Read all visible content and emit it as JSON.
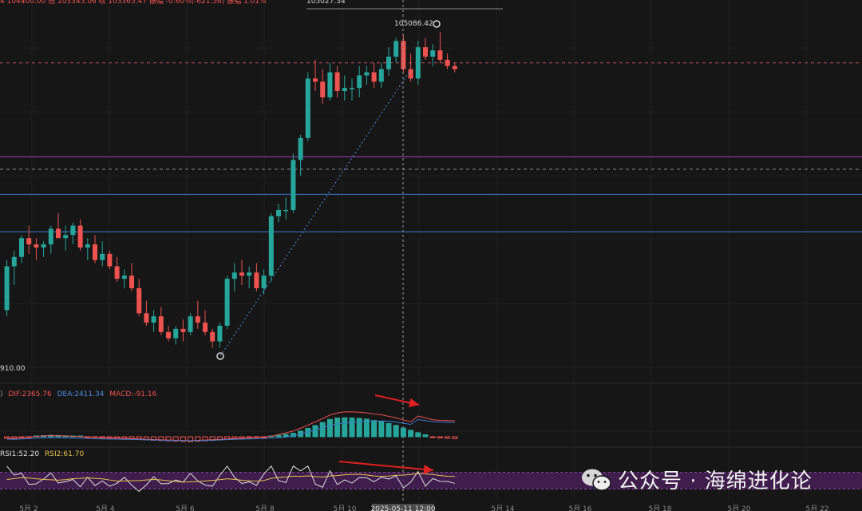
{
  "header": {
    "ohlc_text": "4 104400.00 低 103345.06 收 103365.47 振幅 -0.60%(-621.56) 振幅 1.01%",
    "top_price_label": "105027.34"
  },
  "price_labels": {
    "high": "105086.42",
    "low": "910.00"
  },
  "indicators": {
    "macd_prefix": ")",
    "dif": "DIF:2365.76",
    "dea": "DEA:2411.34",
    "macd": "MACD:-91.16",
    "rsi1": "RSI1:52.20",
    "rsi2": "RSI2:61.70"
  },
  "time_axis": {
    "ticks": [
      "5月 2",
      "5月 4",
      "5月 6",
      "5月 8",
      "5月 10",
      "5月 14",
      "5月 16",
      "5月 18",
      "5月 20",
      "5月 22"
    ],
    "crosshair": "2025-05-11 12:00"
  },
  "watermark": {
    "text": "公众号 · 海绵进化论",
    "icon": "wechat-icon"
  },
  "colors": {
    "up": "#26a69a",
    "down": "#ef5350",
    "background": "#161616"
  },
  "chart_data": {
    "type": "candlestick",
    "asset": "BTC",
    "interval": "4h",
    "candles": [
      [
        96200,
        97800,
        96000,
        97600
      ],
      [
        97600,
        98100,
        97000,
        97900
      ],
      [
        97900,
        98600,
        97700,
        98500
      ],
      [
        98500,
        98900,
        98000,
        98300
      ],
      [
        98300,
        98500,
        97800,
        98200
      ],
      [
        98200,
        98400,
        97900,
        98300
      ],
      [
        98300,
        98900,
        98000,
        98800
      ],
      [
        98800,
        99300,
        98500,
        98500
      ],
      [
        98500,
        98900,
        98100,
        98600
      ],
      [
        98600,
        99000,
        98300,
        98900
      ],
      [
        98900,
        99100,
        98100,
        98200
      ],
      [
        98200,
        98500,
        97800,
        98300
      ],
      [
        98300,
        98600,
        97700,
        97800
      ],
      [
        97800,
        98400,
        97600,
        98000
      ],
      [
        98000,
        98100,
        97500,
        97600
      ],
      [
        97600,
        97900,
        97100,
        97200
      ],
      [
        97200,
        97500,
        96900,
        97300
      ],
      [
        97300,
        97700,
        96800,
        96900
      ],
      [
        96900,
        97200,
        96000,
        96100
      ],
      [
        96100,
        96500,
        95700,
        95800
      ],
      [
        95800,
        96200,
        95500,
        96000
      ],
      [
        96000,
        96300,
        95400,
        95500
      ],
      [
        95500,
        95700,
        95200,
        95300
      ],
      [
        95300,
        95700,
        95100,
        95600
      ],
      [
        95600,
        95900,
        95200,
        95500
      ],
      [
        95500,
        96100,
        95400,
        96000
      ],
      [
        96000,
        96500,
        95600,
        95800
      ],
      [
        95800,
        96200,
        95400,
        95500
      ],
      [
        95500,
        95600,
        95000,
        95200
      ],
      [
        95200,
        95800,
        95000,
        95700
      ],
      [
        95700,
        97300,
        95600,
        97200
      ],
      [
        97200,
        97700,
        96800,
        97400
      ],
      [
        97400,
        97800,
        97000,
        97300
      ],
      [
        97300,
        97600,
        96900,
        97400
      ],
      [
        97400,
        97700,
        96800,
        96900
      ],
      [
        96900,
        97500,
        96700,
        97300
      ],
      [
        97300,
        99300,
        97100,
        99200
      ],
      [
        99200,
        99600,
        99000,
        99400
      ],
      [
        99400,
        99800,
        99100,
        99400
      ],
      [
        99400,
        101200,
        99300,
        101000
      ],
      [
        101000,
        101800,
        100500,
        101700
      ],
      [
        101700,
        103800,
        101600,
        103600
      ],
      [
        103600,
        104200,
        103200,
        103500
      ],
      [
        103500,
        103900,
        102800,
        103000
      ],
      [
        103000,
        104100,
        102900,
        103800
      ],
      [
        103800,
        104000,
        103000,
        103200
      ],
      [
        103200,
        103700,
        102900,
        103300
      ],
      [
        103300,
        103600,
        102900,
        103300
      ],
      [
        103300,
        104000,
        103000,
        103700
      ],
      [
        103700,
        104000,
        103400,
        103800
      ],
      [
        103800,
        104100,
        103300,
        103500
      ],
      [
        103500,
        104100,
        103300,
        103900
      ],
      [
        103900,
        104600,
        103700,
        104300
      ],
      [
        104300,
        104900,
        104100,
        104800
      ],
      [
        104800,
        105000,
        103800,
        103900
      ],
      [
        103900,
        104400,
        103500,
        103600
      ],
      [
        103600,
        104800,
        103400,
        104600
      ],
      [
        104600,
        104900,
        104200,
        104300
      ],
      [
        104300,
        104700,
        104000,
        104500
      ],
      [
        104500,
        105086.42,
        104100,
        104200
      ],
      [
        104200,
        104400,
        103900,
        104000
      ],
      [
        104000,
        104100,
        103800,
        103900
      ]
    ],
    "annotations": {
      "high": 105086.42,
      "top_level": 105027.34,
      "low_label": "910.00"
    },
    "horizontal_levels": [
      {
        "color": "#c05060",
        "style": "dashed",
        "value": 104100
      },
      {
        "color": "#a040c0",
        "style": "solid",
        "value": 101100
      },
      {
        "color": "#888888",
        "style": "dashed",
        "value": 100700
      },
      {
        "color": "#3a7ad0",
        "style": "solid",
        "value": 99900
      },
      {
        "color": "#3a7ad0",
        "style": "solid",
        "value": 98700
      }
    ],
    "macd": {
      "dif": 2365.76,
      "dea": 2411.34,
      "macd": -91.16,
      "dif_color": "#ef5350",
      "dea_color": "#3a7ad0",
      "histogram": [
        -120,
        -150,
        -90,
        -40,
        30,
        80,
        110,
        95,
        70,
        40,
        20,
        -20,
        -60,
        -90,
        -110,
        -130,
        -150,
        -170,
        -200,
        -230,
        -260,
        -280,
        -300,
        -320,
        -340,
        -360,
        -330,
        -300,
        -270,
        -240,
        -200,
        -150,
        -120,
        -90,
        -60,
        -20,
        40,
        110,
        180,
        260,
        420,
        620,
        830,
        1050,
        1280,
        1380,
        1400,
        1390,
        1360,
        1300,
        1200,
        1120,
        980,
        840,
        640,
        480,
        300,
        150,
        -40,
        -90,
        -110,
        -140
      ]
    },
    "rsi": {
      "rsi1": 52.2,
      "rsi2": 61.7,
      "rsi1_color": "#dedede",
      "rsi2_color": "#e6c34a",
      "band": [
        30,
        70
      ]
    }
  }
}
